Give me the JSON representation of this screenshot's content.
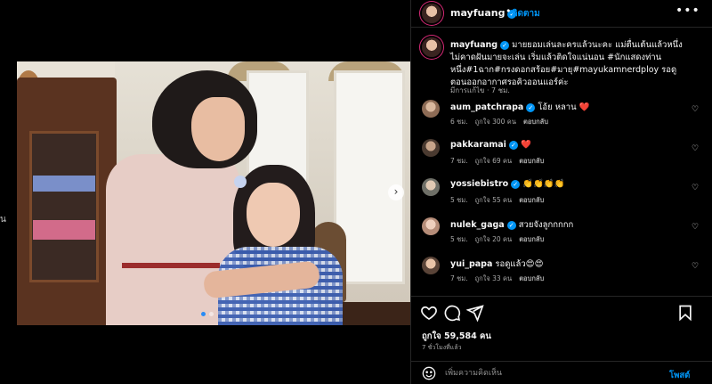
{
  "post": {
    "username": "mayfuang",
    "follow_label": "ติดตาม",
    "header_separator": "•",
    "more_icon": "more-options-icon"
  },
  "caption": {
    "username": "mayfuang",
    "text": "มายยอมเล่นละครแล้วนะคะ แม่ตื่นเต้นแล้วหนึ่ง ไม่คาดฝันมายจะเล่น เริ่มแล้วติดใจแน่นอน #นักแสดงท่านหนึ่ง#1ฉาก#กรงดอกสร้อย#มายุ#mayukamnerdploy รอดูตอนออกอากาศรอคิวออนแอร์ค่ะ",
    "time": "มีการแก้ไข · 7 ชม."
  },
  "comments": [
    {
      "username": "aum_patchrapa",
      "text": "โอ้ย หลาน ❤️",
      "time": "6 ชม.",
      "likes": "ถูกใจ 300 คน",
      "reply": "ตอบกลับ"
    },
    {
      "username": "pakkaramai",
      "text": "❤️",
      "time": "7 ชม.",
      "likes": "ถูกใจ 69 คน",
      "reply": "ตอบกลับ"
    },
    {
      "username": "yossiebistro",
      "text": "👏👏👏👏",
      "time": "5 ชม.",
      "likes": "ถูกใจ 55 คน",
      "reply": "ตอบกลับ"
    },
    {
      "username": "nulek_gaga",
      "text": "สวยจังลูกกกกก",
      "time": "5 ชม.",
      "likes": "ถูกใจ 20 คน",
      "reply": "ตอบกลับ"
    },
    {
      "username": "yui_papa",
      "text": "รอดูแล้ว😍😍",
      "time": "7 ชม.",
      "likes": "ถูกใจ 33 คน",
      "reply": "ตอบกลับ"
    }
  ],
  "actions": {
    "likes": "ถูกใจ 59,584 คน",
    "time": "7 ชั่วโมงที่แล้ว"
  },
  "add_comment": {
    "placeholder": "เพิ่มความคิดเห็น",
    "post_label": "โพสต์"
  },
  "media": {
    "next_icon": "›",
    "edge_glyph": "น",
    "dots_total": 2,
    "dots_active": 1
  },
  "colors": {
    "accent": "#0095f6",
    "background": "#000000",
    "heart": "#ed4956"
  }
}
